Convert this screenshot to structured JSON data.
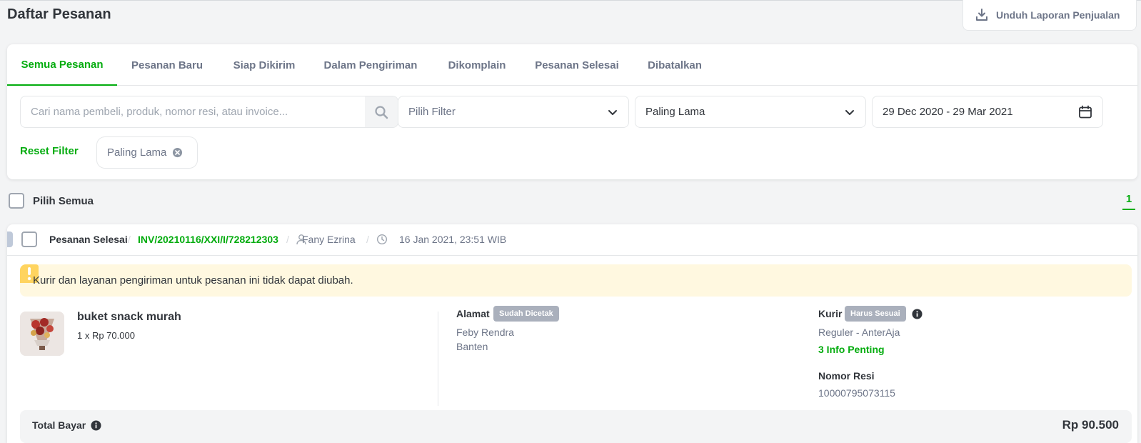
{
  "page": {
    "title": "Daftar Pesanan",
    "download_label": "Unduh Laporan Penjualan"
  },
  "tabs": [
    {
      "label": "Semua Pesanan",
      "active": true
    },
    {
      "label": "Pesanan Baru"
    },
    {
      "label": "Siap Dikirim"
    },
    {
      "label": "Dalam Pengiriman"
    },
    {
      "label": "Dikomplain"
    },
    {
      "label": "Pesanan Selesai"
    },
    {
      "label": "Dibatalkan"
    }
  ],
  "filters": {
    "search_placeholder": "Cari nama pembeli, produk, nomor resi, atau invoice...",
    "filter_placeholder": "Pilih Filter",
    "sort_value": "Paling Lama",
    "date_range": "29 Dec 2020 - 29 Mar 2021",
    "reset_label": "Reset Filter",
    "active_chip": "Paling Lama"
  },
  "list": {
    "select_all_label": "Pilih Semua",
    "current_page": "1"
  },
  "order": {
    "status": "Pesanan Selesai",
    "invoice": "INV/20210116/XXI/I/728212303",
    "buyer": "Fany Ezrina",
    "date": "16 Jan 2021, 23:51 WIB",
    "notice": "Kurir dan layanan pengiriman untuk pesanan ini tidak dapat diubah.",
    "product": {
      "name": "buket snack murah",
      "qty_price": "1 x Rp 70.000"
    },
    "address": {
      "label": "Alamat",
      "badge": "Sudah Dicetak",
      "name": "Feby Rendra",
      "region": "Banten"
    },
    "courier": {
      "label": "Kurir",
      "badge": "Harus Sesuai",
      "service": "Reguler - AnterAja",
      "info_link": "3 Info Penting",
      "resi_label": "Nomor Resi",
      "resi_value": "10000795073115"
    },
    "total": {
      "label": "Total Bayar",
      "value": "Rp 90.500"
    }
  },
  "colors": {
    "primary_green": "#03ac0e",
    "notice_bg": "#fff8e0",
    "badge_grey": "#aab0bc"
  },
  "icons": [
    "download-icon",
    "search-icon",
    "chevron-down-icon",
    "calendar-icon",
    "close-circle-icon",
    "user-icon",
    "clock-icon",
    "warning-icon",
    "info-icon"
  ]
}
